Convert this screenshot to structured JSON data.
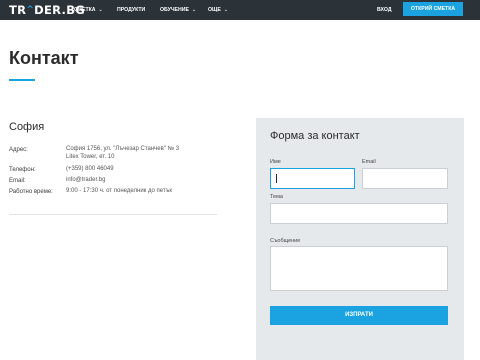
{
  "header": {
    "logo": {
      "left": "TR",
      "accent": "^",
      "right": "DER.BG"
    },
    "nav": [
      {
        "label": "СМЕТКА",
        "has_chevron": true
      },
      {
        "label": "ПРОДУКТИ",
        "has_chevron": false
      },
      {
        "label": "ОБУЧЕНИЕ",
        "has_chevron": true
      },
      {
        "label": "ОЩЕ",
        "has_chevron": true
      }
    ],
    "chevron_icon": "chevron-down-icon",
    "login_label": "ВХОД",
    "open_account_label": "ОТКРИЙ СМЕТКА"
  },
  "page": {
    "title": "Контакт"
  },
  "office": {
    "city": "София",
    "address_label": "Адрес:",
    "address_line1": "София 1756, ул. \"Лъчезар Станчев\" № 3",
    "address_line2": "Litex Tower, ет. 10",
    "phone_label": "Телефон:",
    "phone": "(+359) 800 46049",
    "email_label": "Email:",
    "email": "info@trader.bg",
    "hours_label": "Работно време:",
    "hours": "9:00 - 17:30 ч. от понеделник до петък"
  },
  "form": {
    "title": "Форма за контакт",
    "name_label": "Име",
    "name_value": "",
    "email_label": "Email",
    "email_value": "",
    "subject_label": "Тема",
    "subject_value": "",
    "message_label": "Съобщение",
    "message_value": "",
    "submit_label": "ИЗПРАТИ"
  },
  "colors": {
    "accent": "#1aa3e0",
    "topbar": "#2b3339",
    "panel": "#e5e9ec"
  }
}
